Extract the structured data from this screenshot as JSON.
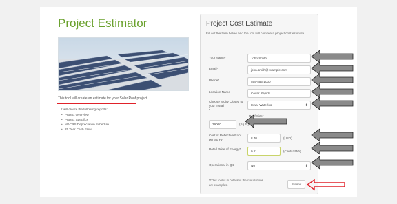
{
  "estimator": {
    "title": "Project Estimator",
    "intro": "This tool will create an estimate for your Solar Roof project.",
    "reports_lead": "It will create the following reports:",
    "reports": [
      "Project Overview",
      "Project Specifics",
      "MACRS Depreciation Schedule",
      "25 Year Cash Flow"
    ]
  },
  "form": {
    "title": "Project Cost Estimate",
    "description": "Fill out the form below and the tool will compile a project cost estimate.",
    "name_label": "Your Name*",
    "name_value": "John Smith",
    "email_label": "Email*",
    "email_value": "john.smith@example.com",
    "phone_label": "Phone*",
    "phone_value": "555-555-1000",
    "location_label": "Location Name",
    "location_value": "Cedar Rapids",
    "city_label": "Choose a City Closes to your Install",
    "city_star": "*",
    "city_value": "Iowa, Waterloo",
    "roof_label": "Roof Size*",
    "roof_value": "39000",
    "roof_unit": "(Sq Ft)",
    "cost_label": "Cost of Reflective Roof per Sq Ft*",
    "cost_value": "8.70",
    "cost_unit": "(USD)",
    "price_label": "Retail Price of Energy*",
    "price_value": "0.11",
    "price_unit": "(Cents/kWh)",
    "q4_label": "Operational in Q4",
    "q4_value": "No",
    "footnote": "**This tool is in beta and the calculations are examples.",
    "submit_label": "Submit"
  },
  "colors": {
    "title_green": "#6aa12d",
    "highlight_red": "#e0222a",
    "arrow_gray": "#8a8a8a"
  }
}
